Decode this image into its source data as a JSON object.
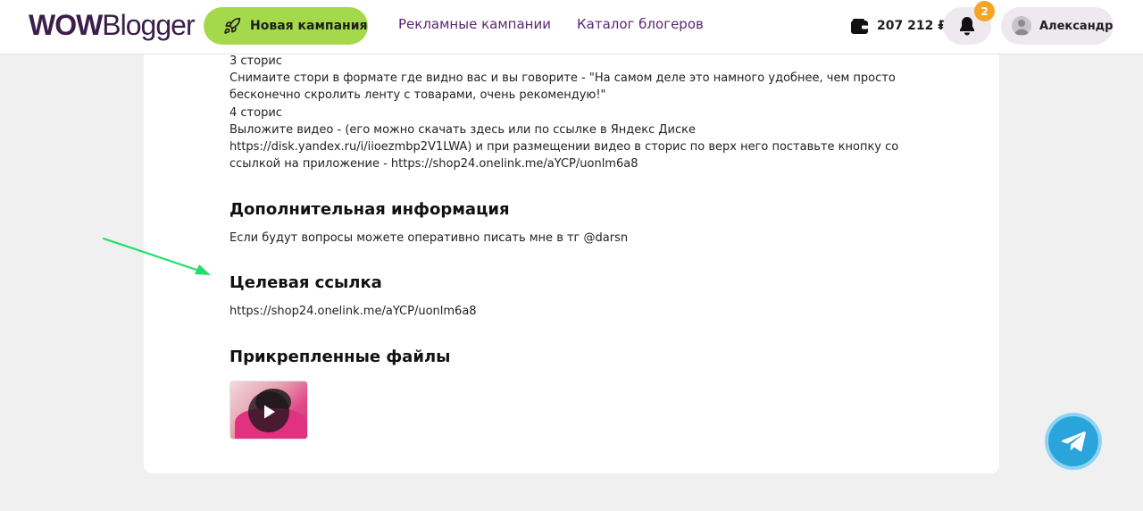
{
  "header": {
    "logo_bold": "WOW",
    "logo_light": "Blogger",
    "new_campaign_label": "Новая кампания",
    "nav": [
      {
        "label": "Рекламные кампании"
      },
      {
        "label": "Каталог блогеров"
      }
    ],
    "balance": "207 212 ₽",
    "notifications_count": "2",
    "user_name": "Александр"
  },
  "content": {
    "instructions": [
      "3 сторис",
      "Снимаите стори в формате где видно вас и вы говорите - \"На самом деле это намного удобнее, чем просто бесконечно скролить ленту с товарами, очень рекомендую!\"",
      "4 сторис",
      "Выложите видео - (его можно скачать здесь или по ссылке в Яндекс Диске https://disk.yandex.ru/i/iioezmbp2V1LWA) и при размещении видео в сторис по верх него поставьте кнопку со ссылкой на приложение - https://shop24.onelink.me/aYCP/uonlm6a8"
    ],
    "additional_title": "Дополнительная информация",
    "additional_text": "Если будут вопросы можете оперативно писать мне в тг @darsn",
    "target_title": "Целевая ссылка",
    "target_url": "https://shop24.onelink.me/aYCP/uonlm6a8",
    "files_title": "Прикрепленные файлы"
  },
  "colors": {
    "accent_green": "#a3d94a",
    "nav_purple": "#5b2674",
    "badge_orange": "#f5a524",
    "telegram_blue": "#2aa5dc",
    "annotation_arrow": "#22e06b"
  },
  "icons": {
    "new_campaign": "rocket-icon",
    "balance": "wallet-icon",
    "notifications": "bell-icon",
    "user": "user-avatar-icon",
    "attachment": "play-icon",
    "chat": "telegram-icon"
  }
}
